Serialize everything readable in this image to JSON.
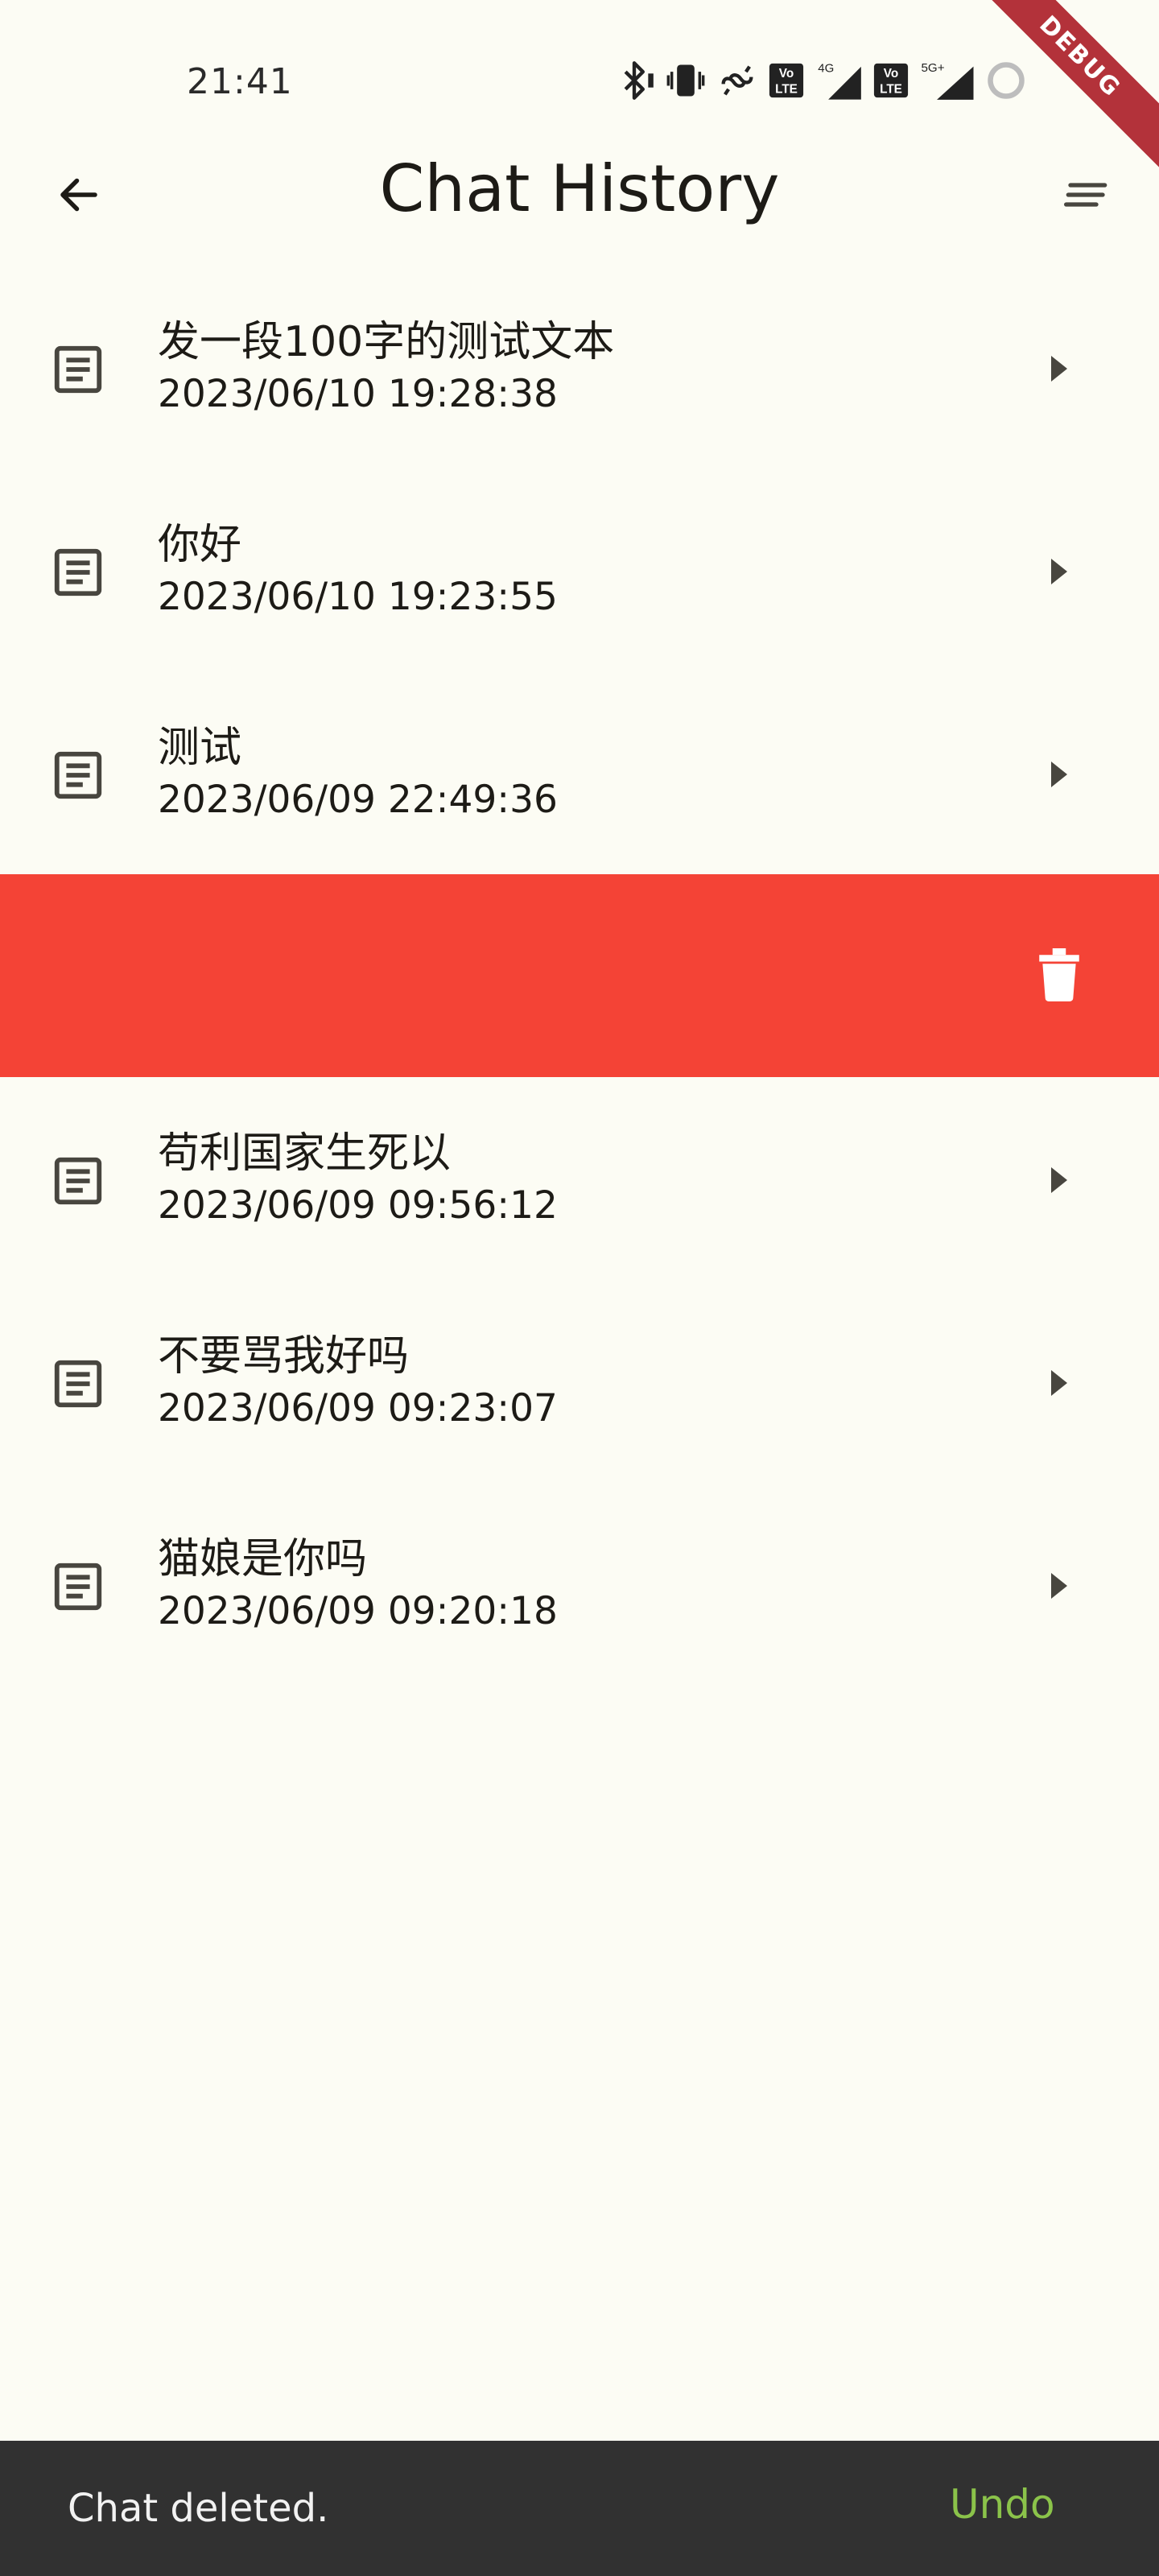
{
  "status_bar": {
    "time": "21:41",
    "icons": [
      "bluetooth-icon",
      "vibrate-icon",
      "link-icon",
      "volte-icon",
      "signal-4g-icon",
      "volte-icon",
      "signal-5g-icon",
      "loading-icon"
    ],
    "labels": {
      "net_4g": "4G",
      "net_5g": "5G+",
      "volte_top": "Vo",
      "volte_bottom": "LTE"
    }
  },
  "debug_banner": "DEBUG",
  "app_bar": {
    "title": "Chat History",
    "back_icon": "arrow-back-icon",
    "sort_icon": "sort-icon"
  },
  "chats": [
    {
      "title": "发一段100字的测试文本",
      "time": "2023/06/10 19:28:38"
    },
    {
      "title": "你好",
      "time": "2023/06/10 19:23:55"
    },
    {
      "title": "测试",
      "time": "2023/06/09 22:49:36"
    },
    {
      "title": "苟利国家生死以",
      "time": "2023/06/09 09:56:12"
    },
    {
      "title": "不要骂我好吗",
      "time": "2023/06/09 09:23:07"
    },
    {
      "title": "猫娘是你吗",
      "time": "2023/06/09 09:20:18"
    }
  ],
  "delete_row": {
    "icon": "trash-icon",
    "color": "#f44336"
  },
  "snackbar": {
    "message": "Chat deleted.",
    "action": "Undo",
    "action_color": "#8bc34a"
  },
  "colors": {
    "background": "#fcfcf4",
    "text": "#1d1b16",
    "icon": "#48463f",
    "snackbar_bg": "#313131"
  }
}
